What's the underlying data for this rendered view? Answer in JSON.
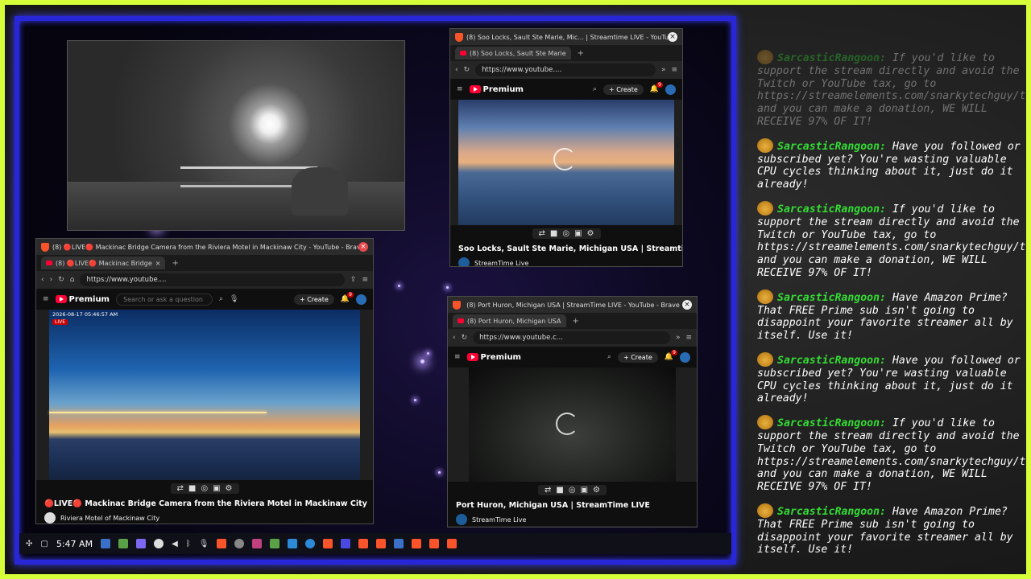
{
  "colors": {
    "outer_border": "#d6ff3a",
    "desktop_border": "#2727d8",
    "username": "#33dd33",
    "live_red": "#cc0000"
  },
  "windows": {
    "soo": {
      "title": "(8) Soo Locks, Sault Ste Marie, Mic... | Streamtime LIVE - YouTube - Brave",
      "tab": "(8) Soo Locks, Sault Ste Marie",
      "url": "https://www.youtube....",
      "video_title": "Soo Locks, Sault Ste Marie, Michigan USA | Streamtime...",
      "channel": "StreamTime Live",
      "create": "Create",
      "notifications": "9"
    },
    "mackinac": {
      "title": "(8) 🔴LIVE🔴 Mackinac Bridge Camera from the Riviera Motel in Mackinaw City - YouTube - Brave",
      "tab": "(8) 🔴LIVE🔴 Mackinac Bridge",
      "url": "https://www.youtube....",
      "search_placeholder": "Search or ask a question",
      "timestamp": "2026-08-17 05:46:57 AM",
      "live": "LIVE",
      "video_title": "🔴LIVE🔴 Mackinac Bridge Camera from the Riviera Motel in Mackinaw City",
      "channel": "Riviera Motel of Mackinaw City",
      "create": "Create",
      "notifications": "9"
    },
    "huron": {
      "title": "(8) Port Huron, Michigan USA | StreamTime LIVE - YouTube - Brave",
      "tab": "(8) Port Huron, Michigan USA",
      "url": "https://www.youtube.c...",
      "video_title": "Port Huron, Michigan USA | StreamTime LIVE",
      "channel": "StreamTime Live",
      "create": "Create",
      "notifications": "9"
    }
  },
  "youtube": {
    "brand": "Premium"
  },
  "taskbar": {
    "clock": "5:47 AM"
  },
  "chat": {
    "username": "SarcasticRangoon:",
    "messages": [
      {
        "text": "If you'd like to support the stream directly and avoid the Twitch or YouTube tax, go to https://streamelements.com/snarkytechguy/tip and you can make a donation, WE WILL RECEIVE 97% OF IT!",
        "faded": true
      },
      {
        "text": "Have you followed or subscribed yet? You're wasting valuable CPU cycles thinking about it, just do it already!",
        "faded": false
      },
      {
        "text": "If you'd like to support the stream directly and avoid the Twitch or YouTube tax, go to https://streamelements.com/snarkytechguy/tip and you can make a donation, WE WILL RECEIVE 97% OF IT!",
        "faded": false
      },
      {
        "text": "Have Amazon Prime? That FREE Prime sub isn't going to disappoint your favorite streamer all by itself. Use it!",
        "faded": false
      },
      {
        "text": "Have you followed or subscribed yet? You're wasting valuable CPU cycles thinking about it, just do it already!",
        "faded": false
      },
      {
        "text": "If you'd like to support the stream directly and avoid the Twitch or YouTube tax, go to https://streamelements.com/snarkytechguy/tip and you can make a donation, WE WILL RECEIVE 97% OF IT!",
        "faded": false
      },
      {
        "text": "Have Amazon Prime? That FREE Prime sub isn't going to disappoint your favorite streamer all by itself. Use it!",
        "faded": false
      }
    ]
  }
}
